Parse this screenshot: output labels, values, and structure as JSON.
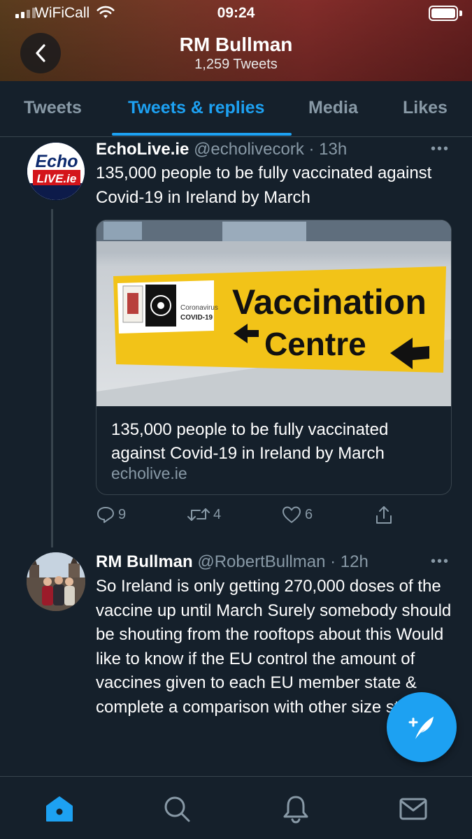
{
  "status_bar": {
    "carrier": "WiFiCall",
    "time": "09:24"
  },
  "header": {
    "title": "RM Bullman",
    "subtitle": "1,259 Tweets"
  },
  "tabs": [
    {
      "label": "Tweets",
      "active": false
    },
    {
      "label": "Tweets & replies",
      "active": true
    },
    {
      "label": "Media",
      "active": false
    },
    {
      "label": "Likes",
      "active": false
    }
  ],
  "tweets": [
    {
      "name": "EchoLive.ie",
      "handle": "@echolivecork",
      "time": "· 13h",
      "text": "135,000 people to be fully vaccinated against Covid-19 in Ireland by March",
      "avatar": {
        "line1": "Echo",
        "line2": "LIVE.ie"
      },
      "card": {
        "sign_main": "Vaccination",
        "sign_sub": "Centre",
        "sign_small_1": "Coronavirus",
        "sign_small_2": "COVID-19",
        "title": "135,000 people to be fully vaccinated against Covid-19 in Ireland by March",
        "domain": "echolive.ie"
      },
      "actions": {
        "replies": "9",
        "retweets": "4",
        "likes": "6"
      }
    },
    {
      "name": "RM Bullman",
      "handle": "@RobertBullman",
      "time": "· 12h",
      "text": "So Ireland is only getting 270,000 doses of the vaccine up until March Surely somebody should be shouting from the rooftops about this Would like to know if the EU control the amount of vaccines given to each EU member state & complete a comparison with other size states"
    }
  ],
  "colors": {
    "background": "#15202b",
    "accent": "#1da1f2",
    "secondary_text": "#8899a6",
    "border": "#38444d"
  },
  "icons": {
    "back": "chevron-left-icon",
    "more": "more-horizontal-icon",
    "reply": "reply-icon",
    "retweet": "retweet-icon",
    "like": "heart-icon",
    "share": "share-icon",
    "compose": "compose-tweet-icon",
    "home": "home-icon",
    "search": "search-icon",
    "notifications": "bell-icon",
    "messages": "mail-icon"
  }
}
